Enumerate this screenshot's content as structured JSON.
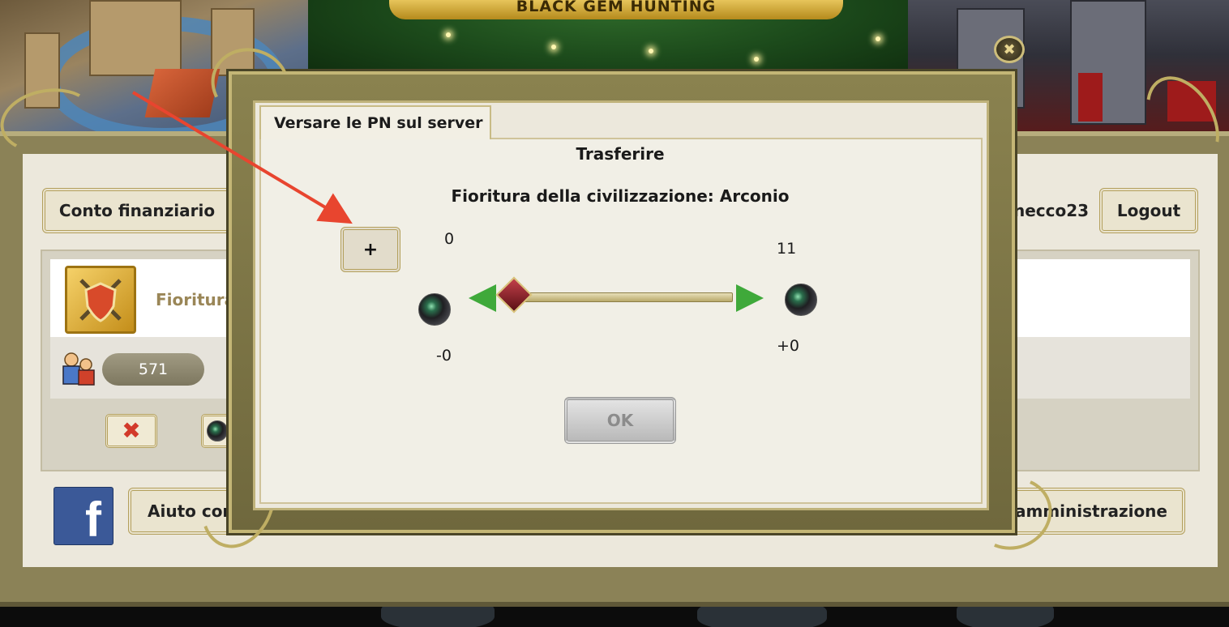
{
  "game": {
    "banner_title": "BLACK GEM HUNTING"
  },
  "background_panel": {
    "account_button": "Conto finanziario",
    "username": "necco23",
    "logout_button": "Logout",
    "card": {
      "title": "Fioritura",
      "population_value": "571"
    },
    "help_button": "Aiuto cor",
    "admin_button": "amministrazione"
  },
  "modal": {
    "tab_label": "Versare le PN sul server",
    "heading": "Trasferire",
    "subheading": "Fioritura della civilizzazione: Arconio",
    "plus_label": "+",
    "left_amount": "0",
    "left_delta": "-0",
    "right_amount": "11",
    "right_delta": "+0",
    "ok_label": "OK",
    "slider_value": 0
  },
  "colors": {
    "panel_gold": "#bfb27a",
    "slider_arrow": "#3fa93a",
    "annotation_arrow": "#e8452f"
  },
  "icons": [
    "close-icon",
    "gem-icon",
    "emblem-shield-pickaxe-icon",
    "people-icon",
    "facebook-icon",
    "cancel-x-icon"
  ]
}
